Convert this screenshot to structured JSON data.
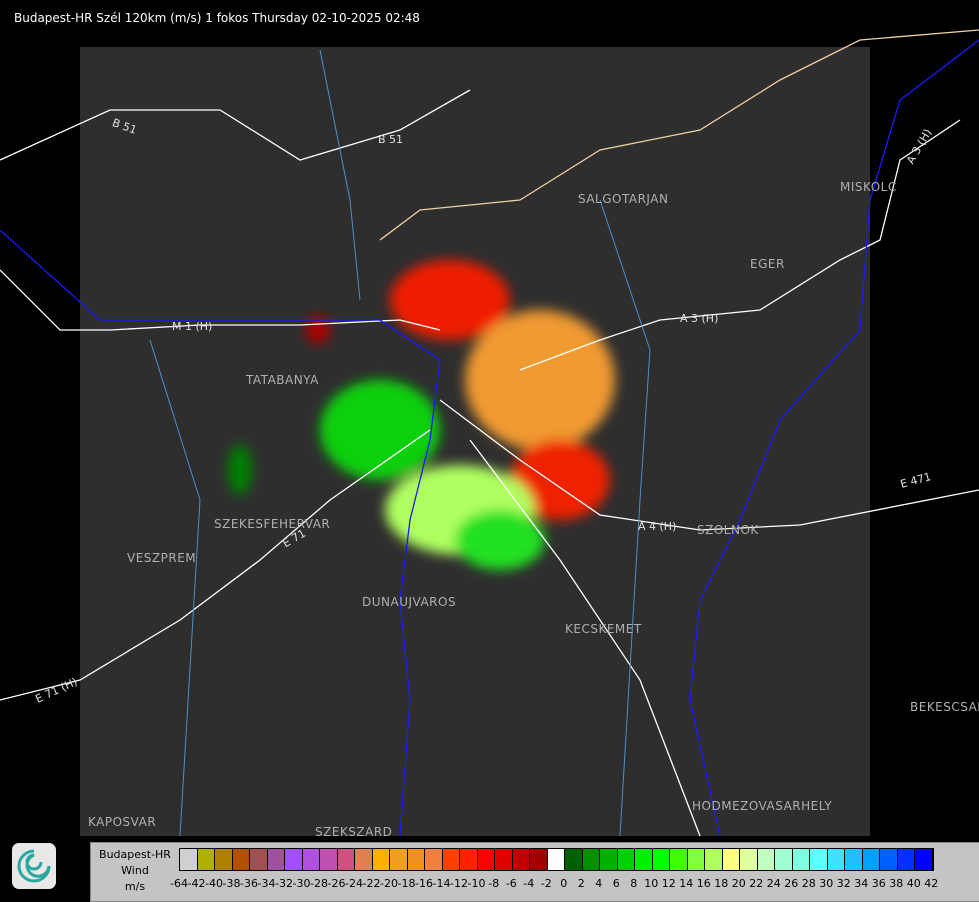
{
  "title": "Budapest-HR Szél 120km (m/s) 1 fokos Thursday 02-10-2025 02:48",
  "cities": [
    "TATABANYA",
    "SZEKESFEHERVAR",
    "VESZPREM",
    "DUNAUJVAROS",
    "KECSKEMET",
    "SALGOTARJAN",
    "EGER",
    "MISKOLC",
    "SZOLNOK",
    "BEKESCSABA",
    "HODMEZOVASARHELY",
    "KAPOSVAR",
    "SZEKSZARD"
  ],
  "roads": [
    "B 51",
    "B 51",
    "M 1 (H)",
    "A 3 (H)",
    "A 4 (H)",
    "E 71 (H)",
    "E 471",
    "A 3 (H)",
    "E 71"
  ],
  "legend": {
    "station": "Budapest-HR",
    "quantity": "Wind",
    "unit": "m/s",
    "labels": [
      "-64",
      "-42",
      "-40",
      "-38",
      "-36",
      "-34",
      "-32",
      "-30",
      "-28",
      "-26",
      "-24",
      "-22",
      "-20",
      "-18",
      "-16",
      "-14",
      "-12",
      "-10",
      "-8",
      "-6",
      "-4",
      "-2",
      "0",
      "2",
      "4",
      "6",
      "8",
      "10",
      "12",
      "14",
      "16",
      "18",
      "20",
      "22",
      "24",
      "26",
      "28",
      "30",
      "32",
      "34",
      "36",
      "38",
      "40",
      "42"
    ],
    "colors": [
      "#d0d0d0",
      "#b0b000",
      "#b08000",
      "#b05000",
      "#a05050",
      "#a050a0",
      "#a050ff",
      "#b050e0",
      "#c050b0",
      "#d05080",
      "#e08050",
      "#ffb000",
      "#f0a020",
      "#f09020",
      "#f08040",
      "#ff4000",
      "#ff2000",
      "#ff0000",
      "#e00000",
      "#c00000",
      "#a00000",
      "#ffffff",
      "#006000",
      "#009000",
      "#00b000",
      "#00d000",
      "#00f000",
      "#00ff00",
      "#40ff00",
      "#80ff40",
      "#b0ff60",
      "#ffff80",
      "#e0ffa0",
      "#c0ffc0",
      "#a0ffd0",
      "#80ffe0",
      "#60ffff",
      "#40e0ff",
      "#20c0ff",
      "#00a0ff",
      "#0060ff",
      "#0030ff",
      "#0000ff"
    ]
  },
  "logo_icon": "weather-service-swirl-logo"
}
